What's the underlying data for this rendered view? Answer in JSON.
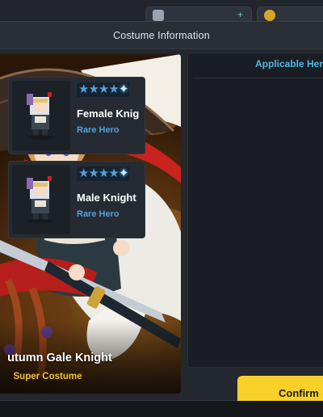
{
  "dialog": {
    "title": "Costume Information"
  },
  "costume": {
    "name": "utumn Gale Knight",
    "grade": "Super Costume"
  },
  "applicable": {
    "header": "Applicable Her",
    "heroes": [
      {
        "name": "Female Knig",
        "rarity": "Rare Hero",
        "stars": 5
      },
      {
        "name": "Male Knight",
        "rarity": "Rare Hero",
        "stars": 5
      }
    ]
  },
  "actions": {
    "confirm_label": "Confirm"
  },
  "colors": {
    "accent_blue": "#4fb8e0",
    "confirm_yellow": "#f7d12a",
    "grade_gold": "#f2c230"
  },
  "icons": [
    "knight-helmet-icon",
    "gold-coin-icon",
    "star-icon"
  ]
}
